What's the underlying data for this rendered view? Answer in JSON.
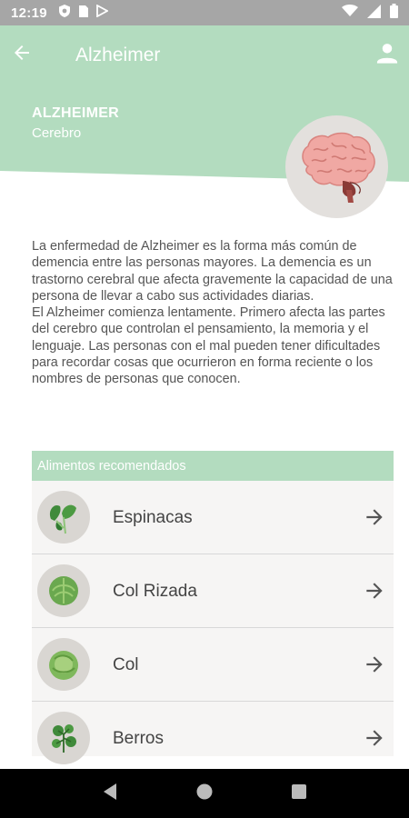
{
  "status": {
    "time": "12:19"
  },
  "appbar": {
    "title": "Alzheimer"
  },
  "hero": {
    "name": "ALZHEIMER",
    "category": "Cerebro"
  },
  "description": [
    "La enfermedad de Alzheimer es la forma más común de demencia entre las personas mayores. La demencia es un trastorno cerebral que afecta gravemente la capacidad de una persona de llevar a cabo sus actividades diarias.",
    "El Alzheimer comienza lentamente. Primero afecta las partes del cerebro que controlan el pensamiento, la memoria y el lenguaje. Las personas con el mal pueden tener dificultades para recordar cosas que ocurrieron en forma reciente o los nombres de personas que conocen."
  ],
  "foods": {
    "header": "Alimentos recomendados",
    "items": [
      {
        "label": "Espinacas",
        "icon": "spinach-icon"
      },
      {
        "label": "Col Rizada",
        "icon": "kale-icon"
      },
      {
        "label": "Col",
        "icon": "cabbage-icon"
      },
      {
        "label": "Berros",
        "icon": "watercress-icon"
      }
    ]
  },
  "colors": {
    "header_green": "#b3dcbf",
    "statusbar": "#a6a6a6"
  }
}
